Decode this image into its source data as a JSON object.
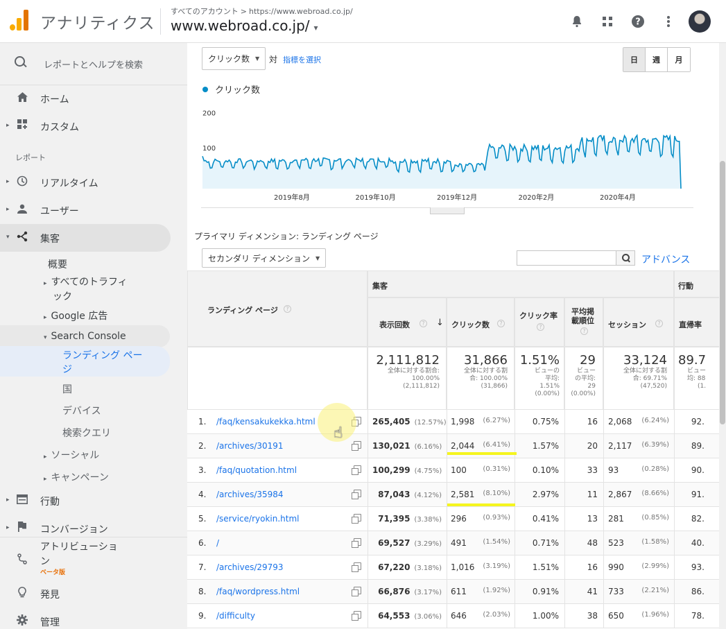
{
  "header": {
    "app_name": "アナリティクス",
    "breadcrumb_all": "すべてのアカウント",
    "breadcrumb_sep": ">",
    "breadcrumb_url": "https://www.webroad.co.jp/",
    "property": "www.webroad.co.jp/",
    "property_caret": "▾",
    "icons": [
      "bell-icon",
      "apps-icon",
      "help-icon",
      "more-icon"
    ]
  },
  "sidebar": {
    "search_label": "レポートとヘルプを検索",
    "home": "ホーム",
    "custom": "カスタム",
    "reports_heading": "レポート",
    "realtime": "リアルタイム",
    "audience": "ユーザー",
    "acquisition": "集客",
    "overview": "概要",
    "all_traffic_1": "すべてのトラフィ",
    "all_traffic_2": "ック",
    "google_ads": "Google 広告",
    "search_console": "Search Console",
    "landing_1": "ランディング ペー",
    "landing_2": "ジ",
    "country": "国",
    "devices": "デバイス",
    "queries": "検索クエリ",
    "social": "ソーシャル",
    "campaigns": "キャンペーン",
    "behavior": "行動",
    "conversions": "コンバージョン",
    "attribution_1": "アトリビューショ",
    "attribution_2": "ン",
    "beta": "ベータ版",
    "discover": "発見",
    "admin": "管理"
  },
  "controls": {
    "metric_select": "クリック数",
    "vs": "対",
    "select_metric_link": "指標を選択",
    "day": "日",
    "week": "週",
    "month": "月",
    "legend": "クリック数",
    "primary_dimension": "プライマリ ディメンション:  ランディング ページ",
    "secondary_dimension": "セカンダリ ディメンション",
    "advanced": "アドバンス"
  },
  "chart_data": {
    "type": "line",
    "series": [
      {
        "name": "クリック数"
      }
    ],
    "yticks": [
      "200",
      "100"
    ],
    "xticks": [
      "2019年8月",
      "2019年10月",
      "2019年12月",
      "2020年2月",
      "2020年4月"
    ],
    "ylim": [
      0,
      260
    ],
    "segments": [
      {
        "days": 60,
        "base": 72,
        "amp": 13
      },
      {
        "days": 60,
        "base": 74,
        "amp": 14
      },
      {
        "days": 38,
        "base": 70,
        "amp": 16
      },
      {
        "days": 22,
        "base": 60,
        "amp": 12
      },
      {
        "days": 60,
        "base": 104,
        "amp": 22
      },
      {
        "days": 64,
        "base": 126,
        "amp": 26
      }
    ],
    "start_value": 92,
    "end_value": 0,
    "grid": false
  },
  "table": {
    "col_landing": "ランディング ページ",
    "group_acq": "集客",
    "group_behavior": "行動",
    "col_impr": "表示回数",
    "col_clicks": "クリック数",
    "col_ctr": "クリック率",
    "col_pos_1": "平均掲",
    "col_pos_2": "載順位",
    "col_sessions": "セッション",
    "col_bounce": "直帰率",
    "totals": {
      "impr": "2,111,812",
      "impr_sub1": "全体に対する割合:",
      "impr_sub2": "100.00%",
      "impr_sub3": "(2,111,812)",
      "clicks": "31,866",
      "clicks_sub1": "全体に対する割",
      "clicks_sub2": "合: 100.00%",
      "clicks_sub3": "(31,866)",
      "ctr": "1.51%",
      "ctr_sub1": "ビューの",
      "ctr_sub2": "平均:",
      "ctr_sub3": "1.51%",
      "ctr_sub4": "(0.00%)",
      "pos": "29",
      "pos_sub1": "ビュー",
      "pos_sub2": "の平均:",
      "pos_sub3": "29",
      "pos_sub4": "(0.00%)",
      "sessions": "33,124",
      "sessions_sub1": "全体に対する割",
      "sessions_sub2": "合: 69.71%",
      "sessions_sub3": "(47,520)",
      "bounce": "89.7",
      "bounce_sub1": "ビュー",
      "bounce_sub2": "均: 88",
      "bounce_sub3": "(1."
    },
    "rows": [
      {
        "n": "1.",
        "page": "/faq/kensakukekka.html",
        "impr": "265,405",
        "impr_pct": "(12.57%)",
        "clicks": "1,998",
        "clicks_pct": "(6.27%)",
        "ctr": "0.75%",
        "pos": "16",
        "sessions": "2,068",
        "sessions_pct": "(6.24%)",
        "bounce": "92."
      },
      {
        "n": "2.",
        "page": "/archives/30191",
        "impr": "130,021",
        "impr_pct": "(6.16%)",
        "clicks": "2,044",
        "clicks_pct": "(6.41%)",
        "ctr": "1.57%",
        "pos": "20",
        "sessions": "2,117",
        "sessions_pct": "(6.39%)",
        "bounce": "89."
      },
      {
        "n": "3.",
        "page": "/faq/quotation.html",
        "impr": "100,299",
        "impr_pct": "(4.75%)",
        "clicks": "100",
        "clicks_pct": "(0.31%)",
        "ctr": "0.10%",
        "pos": "33",
        "sessions": "93",
        "sessions_pct": "(0.28%)",
        "bounce": "90."
      },
      {
        "n": "4.",
        "page": "/archives/35984",
        "impr": "87,043",
        "impr_pct": "(4.12%)",
        "clicks": "2,581",
        "clicks_pct": "(8.10%)",
        "ctr": "2.97%",
        "pos": "11",
        "sessions": "2,867",
        "sessions_pct": "(8.66%)",
        "bounce": "91."
      },
      {
        "n": "5.",
        "page": "/service/ryokin.html",
        "impr": "71,395",
        "impr_pct": "(3.38%)",
        "clicks": "296",
        "clicks_pct": "(0.93%)",
        "ctr": "0.41%",
        "pos": "13",
        "sessions": "281",
        "sessions_pct": "(0.85%)",
        "bounce": "82."
      },
      {
        "n": "6.",
        "page": "/",
        "impr": "69,527",
        "impr_pct": "(3.29%)",
        "clicks": "491",
        "clicks_pct": "(1.54%)",
        "ctr": "0.71%",
        "pos": "48",
        "sessions": "523",
        "sessions_pct": "(1.58%)",
        "bounce": "40."
      },
      {
        "n": "7.",
        "page": "/archives/29793",
        "impr": "67,220",
        "impr_pct": "(3.18%)",
        "clicks": "1,016",
        "clicks_pct": "(3.19%)",
        "ctr": "1.51%",
        "pos": "16",
        "sessions": "990",
        "sessions_pct": "(2.99%)",
        "bounce": "93."
      },
      {
        "n": "8.",
        "page": "/faq/wordpress.html",
        "impr": "66,876",
        "impr_pct": "(3.17%)",
        "clicks": "611",
        "clicks_pct": "(1.92%)",
        "ctr": "0.91%",
        "pos": "41",
        "sessions": "733",
        "sessions_pct": "(2.21%)",
        "bounce": "86."
      },
      {
        "n": "9.",
        "page": "/difficulty",
        "impr": "64,553",
        "impr_pct": "(3.06%)",
        "clicks": "646",
        "clicks_pct": "(2.03%)",
        "ctr": "1.00%",
        "pos": "38",
        "sessions": "650",
        "sessions_pct": "(1.96%)",
        "bounce": "78."
      }
    ]
  },
  "colors": {
    "brand_orange": "#f9ab00",
    "series_line": "#058dc7",
    "series_fill": "#e6f4fb",
    "link": "#1a73e8",
    "highlight": "#f5f51e"
  }
}
